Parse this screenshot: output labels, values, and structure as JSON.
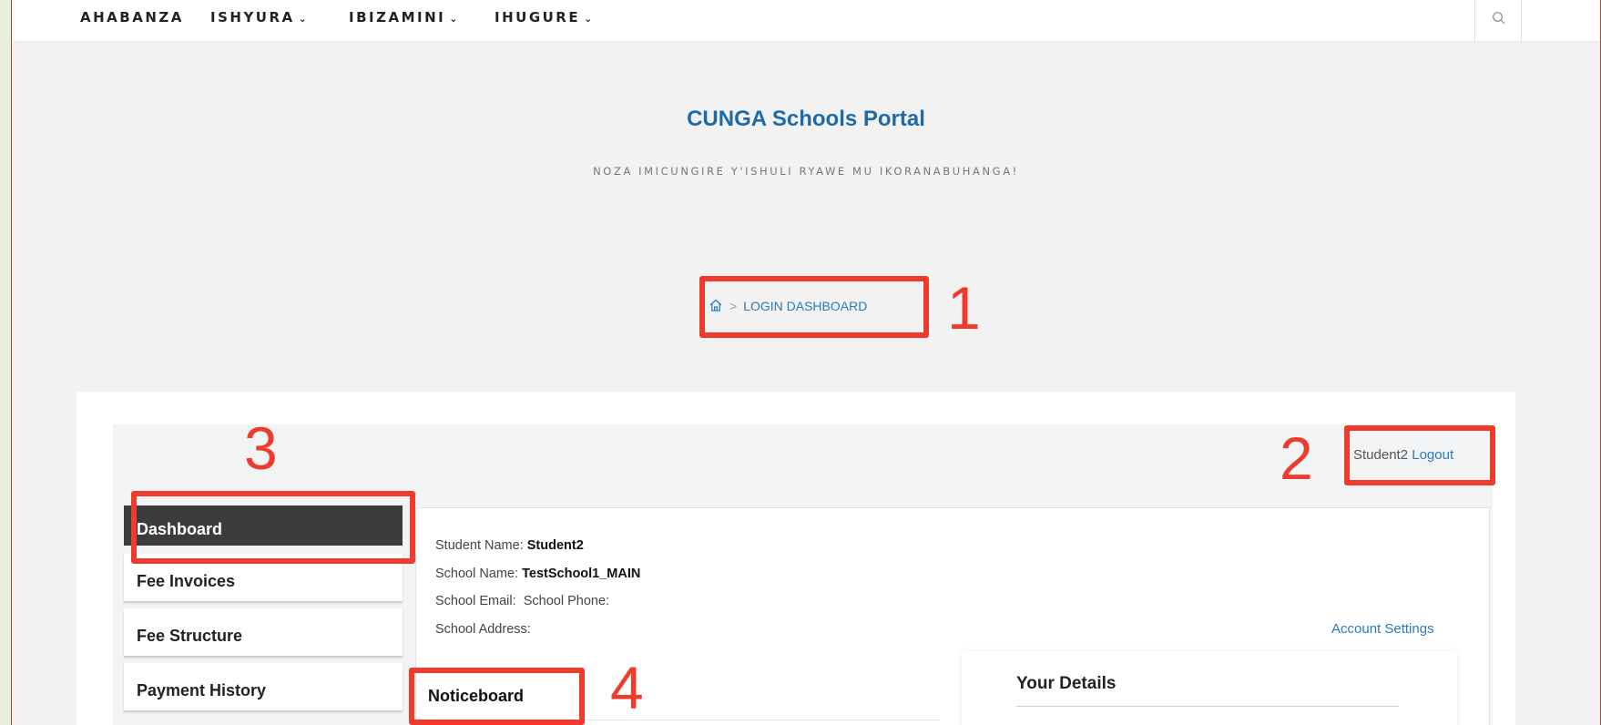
{
  "nav": {
    "items": [
      {
        "label": "AHABANZA",
        "has_dropdown": false
      },
      {
        "label": "ISHYURA",
        "has_dropdown": true
      },
      {
        "label": "IBIZAMINI",
        "has_dropdown": true
      },
      {
        "label": "IHUGURE",
        "has_dropdown": true
      }
    ],
    "search_icon": "search-icon",
    "dropdown_icon": "chevron-down-icon"
  },
  "header": {
    "site_title": "CUNGA Schools Portal",
    "tagline": "NOZA IMICUNGIRE Y'ISHULI RYAWE MU IKORANABUHANGA!"
  },
  "breadcrumb": {
    "home_icon": "home-icon",
    "separator": ">",
    "current": "LOGIN DASHBOARD"
  },
  "user": {
    "name": "Student2",
    "logout_label": "Logout"
  },
  "sidebar": {
    "items": [
      {
        "label": "Dashboard",
        "active": true
      },
      {
        "label": "Fee Invoices",
        "active": false
      },
      {
        "label": "Fee Structure",
        "active": false
      },
      {
        "label": "Payment History",
        "active": false
      }
    ]
  },
  "info": {
    "student_name_label": "Student Name:",
    "student_name_value": "Student2",
    "school_name_label": "School Name:",
    "school_name_value": "TestSchool1_MAIN",
    "school_email_label": "School Email:",
    "school_phone_label": "School Phone:",
    "school_address_label": "School Address:"
  },
  "account_settings_label": "Account Settings",
  "noticeboard_title": "Noticeboard",
  "details_title": "Your Details",
  "annotations": {
    "labels": [
      "1",
      "2",
      "3",
      "4"
    ],
    "color": "#ef3b2c"
  },
  "colors": {
    "link": "#2b7bbd",
    "title": "#1f6aa6",
    "active_menu_bg": "#3c3c3c",
    "outer_bg": "#e8eedd"
  }
}
